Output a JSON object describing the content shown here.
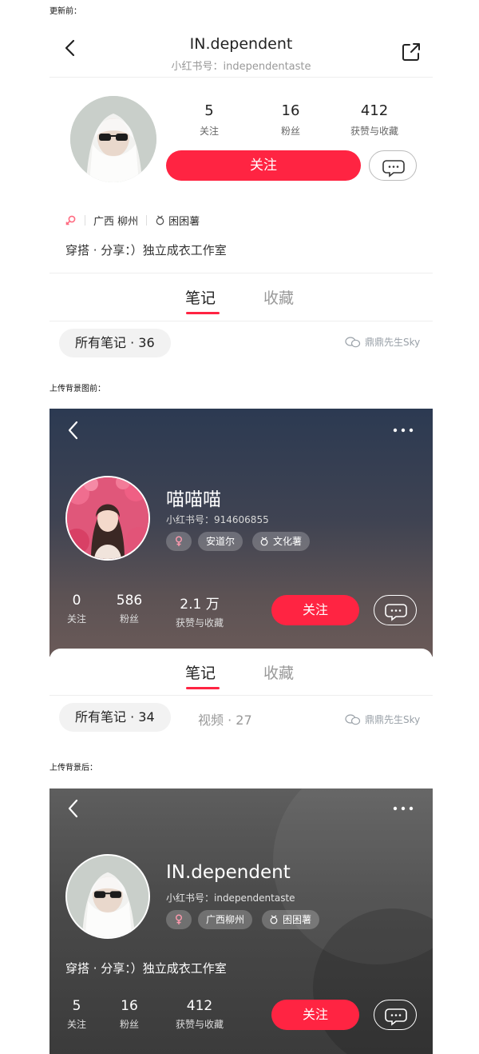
{
  "captions": {
    "before_update": "更新前：",
    "before_bg_upload": "上传背景图前：",
    "after_bg_upload": "上传背景后："
  },
  "profile_before_update": {
    "title": "IN.dependent",
    "subtitle": "小红书号：independentaste",
    "stats": [
      {
        "value": "5",
        "label": "关注"
      },
      {
        "value": "16",
        "label": "粉丝"
      },
      {
        "value": "412",
        "label": "获赞与收藏"
      }
    ],
    "follow_label": "关注",
    "location": "广西 柳州",
    "badge": "困困薯",
    "bio": "穿搭 · 分享：）独立成衣工作室",
    "tabs": [
      "笔记",
      "收藏"
    ],
    "notes_filter": "所有笔记 · 36",
    "watermark": "鼎鼎先生Sky"
  },
  "profile_before_bg": {
    "name": "喵喵喵",
    "uid": "小红书号：914606855",
    "tags": [
      "安道尔",
      "文化薯"
    ],
    "stats": [
      {
        "value": "0",
        "label": "关注"
      },
      {
        "value": "586",
        "label": "粉丝"
      },
      {
        "value": "2.1 万",
        "label": "获赞与收藏"
      }
    ],
    "follow_label": "关注",
    "tabs": [
      "笔记",
      "收藏"
    ],
    "notes_filter": "所有笔记 · 34",
    "video_filter": "视频 · 27",
    "watermark": "鼎鼎先生Sky"
  },
  "profile_after_bg": {
    "name": "IN.dependent",
    "uid": "小红书号：independentaste",
    "tags": [
      "广西柳州",
      "困困薯"
    ],
    "bio": "穿搭 · 分享：）独立成衣工作室",
    "stats": [
      {
        "value": "5",
        "label": "关注"
      },
      {
        "value": "16",
        "label": "粉丝"
      },
      {
        "value": "412",
        "label": "获赞与收藏"
      }
    ],
    "follow_label": "关注"
  },
  "colors": {
    "accent": "#ff2442",
    "text_primary": "#222222",
    "text_secondary": "#999999"
  }
}
